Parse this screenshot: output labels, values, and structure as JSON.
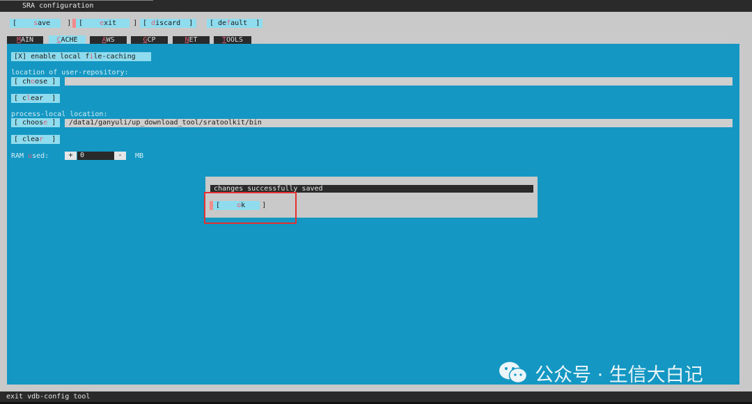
{
  "window": {
    "title": "SRA configuration"
  },
  "toolbar": {
    "save": {
      "pre": "[    ",
      "hot": "s",
      "post": "ave    ]"
    },
    "exit": {
      "pre": "[    ",
      "hot": "e",
      "post": "xit    ]"
    },
    "discard": {
      "pre": "[ ",
      "hot": "d",
      "post": "iscard  ]"
    },
    "default": {
      "pre": "[ de",
      "hot": "f",
      "post": "ault  ]"
    }
  },
  "tabs": [
    {
      "hot": "M",
      "rest": "AIN"
    },
    {
      "hot": "C",
      "rest": "ACHE"
    },
    {
      "hot": "A",
      "rest": "WS"
    },
    {
      "hot": "G",
      "rest": "CP"
    },
    {
      "hot": "N",
      "rest": "ET"
    },
    {
      "hot": "T",
      "rest": "OOLS"
    }
  ],
  "cache": {
    "local_caching": {
      "pre": "[X] enable local f",
      "hot": "i",
      "post": "le-caching"
    },
    "user_repo_label": "location of user-repository:",
    "user_repo_choose": {
      "pre": "[ ch",
      "hot": "o",
      "post": "ose ]"
    },
    "user_repo_value": "",
    "user_repo_clear": {
      "pre": "[ c",
      "hot": "l",
      "post": "ear  ]"
    },
    "process_label": "process-local location:",
    "process_choose": {
      "pre": "[ choos",
      "hot": "e",
      "post": " ]"
    },
    "process_value": "/data1/ganyuli/up_download_tool/sratoolkit/bin",
    "process_clear": {
      "pre": "[ clea",
      "hot": "r",
      "post": "  ]"
    },
    "ram": {
      "label_pre": "RAM ",
      "label_hot": "u",
      "label_post": "sed:",
      "plus": "+",
      "value": "0",
      "minus": "-",
      "unit": "MB"
    }
  },
  "dialog": {
    "message": "changes successfully saved",
    "ok": {
      "pre": "[    ",
      "hot": "o",
      "post": "k    ]"
    }
  },
  "status": {
    "text": "exit vdb-config tool"
  },
  "watermark": {
    "text": "公众号 · 生信大白记"
  },
  "colors": {
    "panel": "#1497c3",
    "button": "#8fdcef",
    "hotkey": "#e0607a",
    "highlight": "#e53030"
  }
}
